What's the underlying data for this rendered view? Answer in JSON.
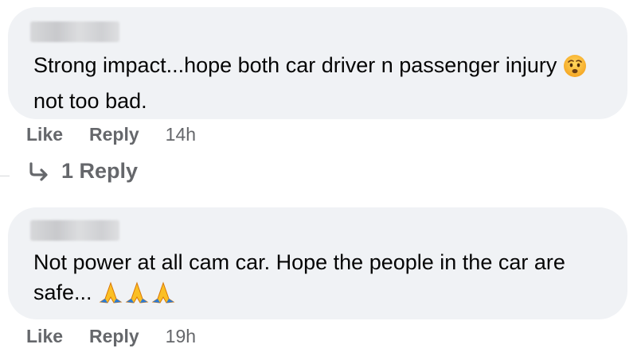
{
  "comments": [
    {
      "text_before_emoji": "Strong impact...hope both car driver n passenger injury",
      "emoji": "worried-face",
      "text_after_emoji": "not too bad.",
      "like_label": "Like",
      "reply_label": "Reply",
      "timestamp": "14h",
      "replies_label": "1 Reply"
    },
    {
      "text_before_emoji": "Not power at all cam car. Hope the people in the car are safe...",
      "emoji": "folded-hands",
      "emoji_count": 3,
      "like_label": "Like",
      "reply_label": "Reply",
      "timestamp": "19h"
    }
  ],
  "colors": {
    "bubble_bg": "#f0f2f5",
    "secondary_text": "#65676b",
    "primary_text": "#050505"
  }
}
